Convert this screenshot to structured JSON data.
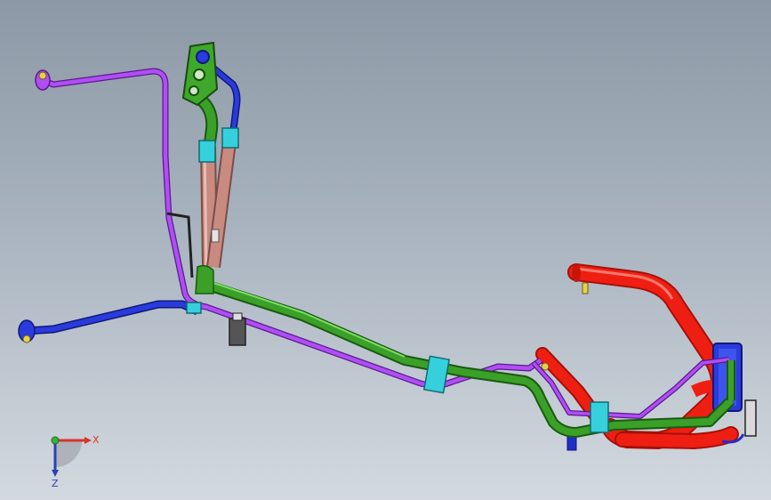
{
  "viewport": {
    "background_top": "#8d98a6",
    "background_bottom": "#d3d9df"
  },
  "model": {
    "parts": [
      "purple-pipe",
      "blue-pipe",
      "green-pipe",
      "pink-pipes",
      "red-hose",
      "connector-plate",
      "clips",
      "fittings"
    ],
    "colors": {
      "purple": "#9a36e0",
      "blue": "#1f2ec9",
      "green": "#2e8a1c",
      "pink": "#c98a80",
      "red": "#ee1f12",
      "cyan": "#35d0dc",
      "plate": "#3ea82a"
    }
  },
  "triad": {
    "x_label": "X",
    "z_label": "Z",
    "x_color": "#d9342b",
    "y_color": "#2fb53a",
    "z_color": "#2a3fb8"
  }
}
